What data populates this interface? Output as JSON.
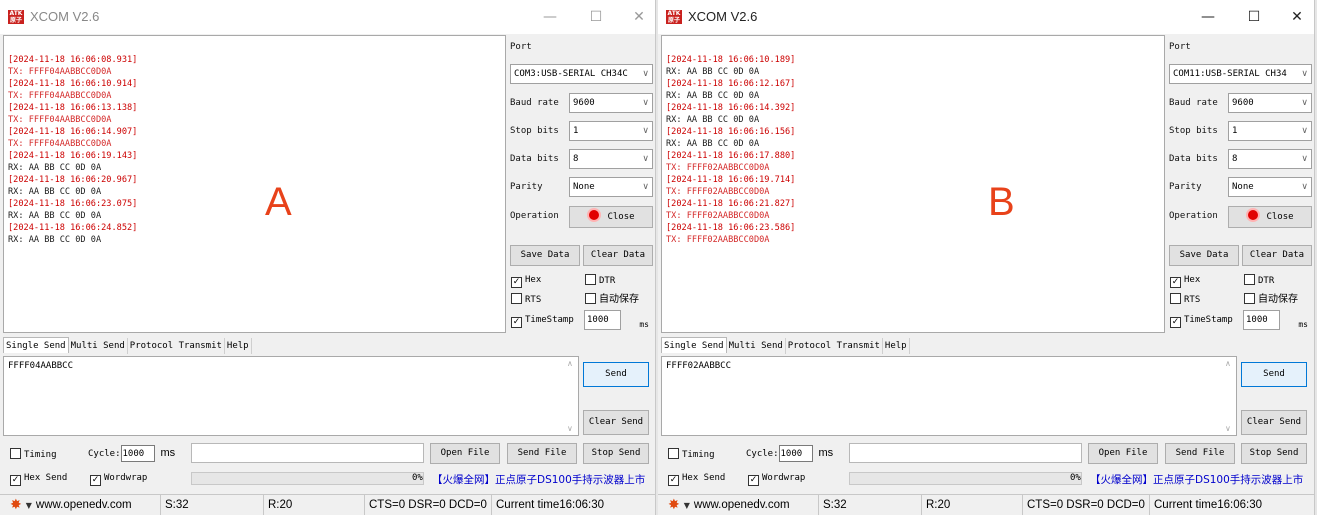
{
  "windows": [
    {
      "title": "XCOM V2.6",
      "icon_text": "ATK 原子",
      "window_buttons": {
        "minimize": "—",
        "maximize": "☐",
        "close": "✕"
      },
      "big_label": "A",
      "log": [
        {
          "kind": "ts",
          "text": "[2024-11-18 16:06:08.931]"
        },
        {
          "kind": "tx",
          "text": "TX: FFFF04AABBCC0D0A"
        },
        {
          "kind": "ts",
          "text": "[2024-11-18 16:06:10.914]"
        },
        {
          "kind": "tx",
          "text": "TX: FFFF04AABBCC0D0A"
        },
        {
          "kind": "ts",
          "text": "[2024-11-18 16:06:13.138]"
        },
        {
          "kind": "tx",
          "text": "TX: FFFF04AABBCC0D0A"
        },
        {
          "kind": "ts",
          "text": "[2024-11-18 16:06:14.907]"
        },
        {
          "kind": "tx",
          "text": "TX: FFFF04AABBCC0D0A"
        },
        {
          "kind": "ts",
          "text": "[2024-11-18 16:06:19.143]"
        },
        {
          "kind": "rx",
          "text": "RX: AA BB CC 0D 0A"
        },
        {
          "kind": "ts",
          "text": "[2024-11-18 16:06:20.967]"
        },
        {
          "kind": "rx",
          "text": "RX: AA BB CC 0D 0A"
        },
        {
          "kind": "ts",
          "text": "[2024-11-18 16:06:23.075]"
        },
        {
          "kind": "rx",
          "text": "RX: AA BB CC 0D 0A"
        },
        {
          "kind": "ts",
          "text": "[2024-11-18 16:06:24.852]"
        },
        {
          "kind": "rx",
          "text": "RX: AA BB CC 0D 0A"
        }
      ],
      "port_label": "Port",
      "port_value": "COM3:USB-SERIAL CH34C",
      "baud_label": "Baud rate",
      "baud_value": "9600",
      "stop_label": "Stop bits",
      "stop_value": "1",
      "data_label": "Data bits",
      "data_value": "8",
      "parity_label": "Parity",
      "parity_value": "None",
      "operation_label": "Operation",
      "close_label": "Close",
      "save_data": "Save Data",
      "clear_data": "Clear Data",
      "hex_label": "Hex",
      "hex_checked": "✓",
      "dtr_label": "DTR",
      "rts_label": "RTS",
      "autosave_label": "自动保存",
      "timestamp_label": "TimeStamp",
      "timestamp_checked": "✓",
      "timestamp_value": "1000",
      "ms_label": "ms",
      "tabs": [
        "Single Send",
        "Multi Send",
        "Protocol Transmit",
        "Help"
      ],
      "send_text": "FFFF04AABBCC",
      "send_button": "Send",
      "clear_send": "Clear Send",
      "timing_label": "Timing",
      "cycle_label": "Cycle:",
      "cycle_value": "1000",
      "cycle_unit": "ms",
      "open_file": "Open File",
      "send_file": "Send File",
      "stop_send": "Stop Send",
      "hex_send_label": "Hex Send",
      "hex_send_checked": "✓",
      "wordwrap_label": "Wordwrap",
      "wordwrap_checked": "✓",
      "progress_percent": "0%",
      "promo": "【火爆全网】正点原子DS100手持示波器上市",
      "status": {
        "url": "www.openedv.com",
        "sent": "S:32",
        "received": "R:20",
        "lines": "CTS=0 DSR=0 DCD=0",
        "time": "Current time16:06:30"
      }
    },
    {
      "title": "XCOM V2.6",
      "icon_text": "ATK 原子",
      "window_buttons": {
        "minimize": "—",
        "maximize": "☐",
        "close": "✕"
      },
      "big_label": "B",
      "log": [
        {
          "kind": "ts",
          "text": "[2024-11-18 16:06:10.189]"
        },
        {
          "kind": "rx",
          "text": "RX: AA BB CC 0D 0A"
        },
        {
          "kind": "ts",
          "text": "[2024-11-18 16:06:12.167]"
        },
        {
          "kind": "rx",
          "text": "RX: AA BB CC 0D 0A"
        },
        {
          "kind": "ts",
          "text": "[2024-11-18 16:06:14.392]"
        },
        {
          "kind": "rx",
          "text": "RX: AA BB CC 0D 0A"
        },
        {
          "kind": "ts",
          "text": "[2024-11-18 16:06:16.156]"
        },
        {
          "kind": "rx",
          "text": "RX: AA BB CC 0D 0A"
        },
        {
          "kind": "ts",
          "text": "[2024-11-18 16:06:17.880]"
        },
        {
          "kind": "tx",
          "text": "TX: FFFF02AABBCC0D0A"
        },
        {
          "kind": "ts",
          "text": "[2024-11-18 16:06:19.714]"
        },
        {
          "kind": "tx",
          "text": "TX: FFFF02AABBCC0D0A"
        },
        {
          "kind": "ts",
          "text": "[2024-11-18 16:06:21.827]"
        },
        {
          "kind": "tx",
          "text": "TX: FFFF02AABBCC0D0A"
        },
        {
          "kind": "ts",
          "text": "[2024-11-18 16:06:23.586]"
        },
        {
          "kind": "tx",
          "text": "TX: FFFF02AABBCC0D0A"
        }
      ],
      "port_label": "Port",
      "port_value": "COM11:USB-SERIAL CH34",
      "baud_label": "Baud rate",
      "baud_value": "9600",
      "stop_label": "Stop bits",
      "stop_value": "1",
      "data_label": "Data bits",
      "data_value": "8",
      "parity_label": "Parity",
      "parity_value": "None",
      "operation_label": "Operation",
      "close_label": "Close",
      "save_data": "Save Data",
      "clear_data": "Clear Data",
      "hex_label": "Hex",
      "hex_checked": "✓",
      "dtr_label": "DTR",
      "rts_label": "RTS",
      "autosave_label": "自动保存",
      "timestamp_label": "TimeStamp",
      "timestamp_checked": "✓",
      "timestamp_value": "1000",
      "ms_label": "ms",
      "tabs": [
        "Single Send",
        "Multi Send",
        "Protocol Transmit",
        "Help"
      ],
      "send_text": "FFFF02AABBCC",
      "send_button": "Send",
      "clear_send": "Clear Send",
      "timing_label": "Timing",
      "cycle_label": "Cycle:",
      "cycle_value": "1000",
      "cycle_unit": "ms",
      "open_file": "Open File",
      "send_file": "Send File",
      "stop_send": "Stop Send",
      "hex_send_label": "Hex Send",
      "hex_send_checked": "✓",
      "wordwrap_label": "Wordwrap",
      "wordwrap_checked": "✓",
      "progress_percent": "0%",
      "promo": "【火爆全网】正点原子DS100手持示波器上市",
      "status": {
        "url": "www.openedv.com",
        "sent": "S:32",
        "received": "R:20",
        "lines": "CTS=0 DSR=0 DCD=0",
        "time": "Current time16:06:30"
      }
    }
  ],
  "colors": {
    "timestamp": "#cc0000",
    "tx": "#d42a2a",
    "rx": "#202020",
    "big_label": "#e8421a",
    "promo": "#0000cc",
    "led": "#e10000",
    "gear": "#e04a10"
  },
  "icons": {
    "app": "atk-logo-icon",
    "settings": "gear-icon",
    "dropdown": "chevron-down-icon",
    "status_led": "red-led-icon"
  }
}
